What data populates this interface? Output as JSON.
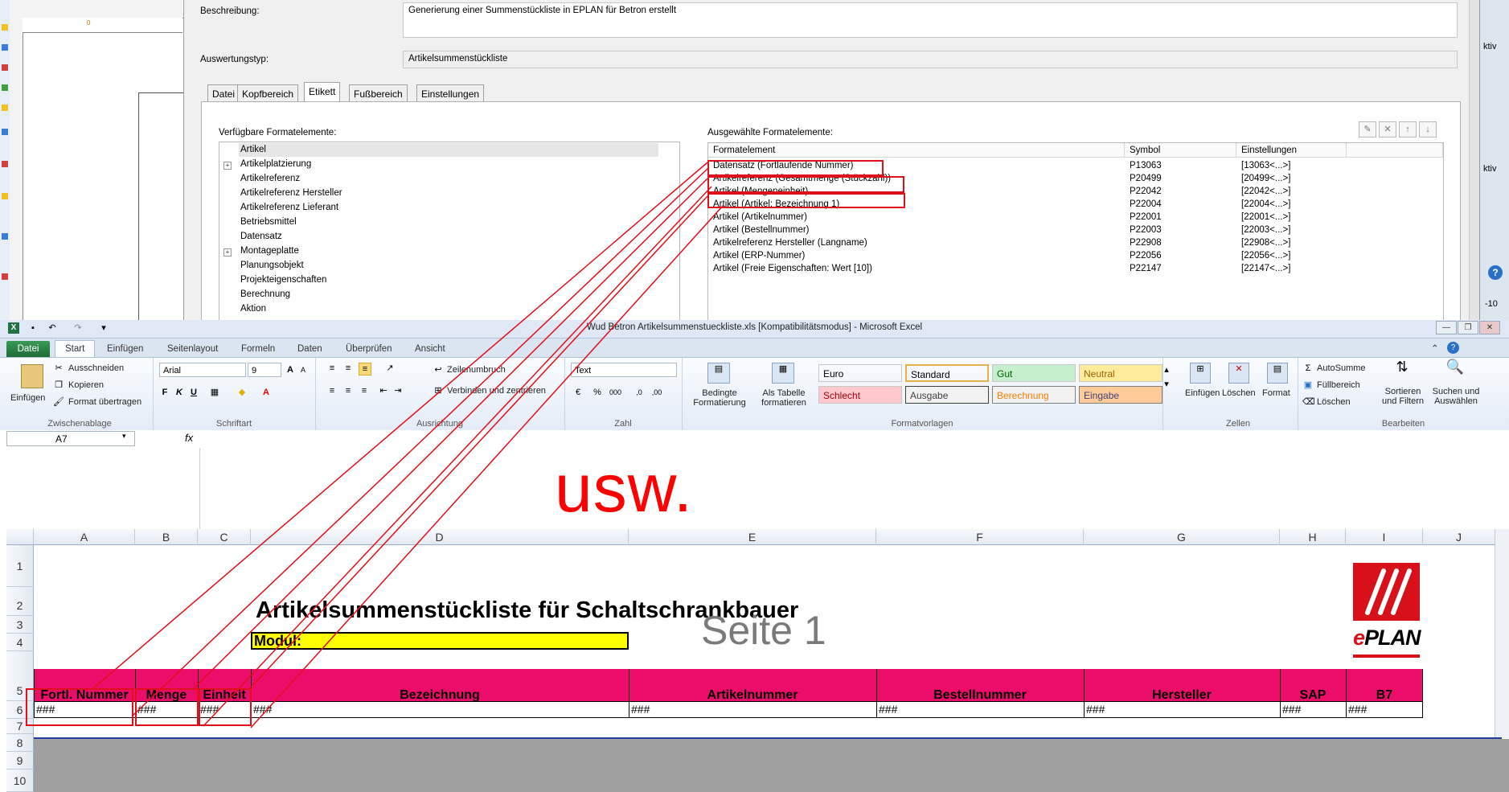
{
  "eplan": {
    "ruler_value": "0",
    "beschreibung_label": "Beschreibung:",
    "beschreibung_value": "Generierung einer Summenstückliste in EPLAN für Betron erstellt",
    "auswertungstyp_label": "Auswertungstyp:",
    "auswertungstyp_value": "Artikelsummenstückliste",
    "tabs": [
      "Datei",
      "Kopfbereich",
      "Etikett",
      "Fußbereich",
      "Einstellungen"
    ],
    "active_tab": "Etikett",
    "available_label": "Verfügbare Formatelemente:",
    "selected_label": "Ausgewählte Formatelemente:",
    "tree_items": [
      "Artikel",
      "Artikelplatzierung",
      "Artikelreferenz",
      "Artikelreferenz Hersteller",
      "Artikelreferenz Lieferant",
      "Betriebsmittel",
      "Datensatz",
      "Montageplatte",
      "Planungsobjekt",
      "Projekteigenschaften",
      "Berechnung",
      "Aktion"
    ],
    "grid_headers": [
      "Formatelement",
      "Symbol",
      "Einstellungen"
    ],
    "grid_rows": [
      {
        "element": "Datensatz (Fortlaufende Nummer)",
        "symbol": "P13063",
        "settings": "[13063<...>]"
      },
      {
        "element": "Artikelreferenz (Gesamtmenge (Stückzahl))",
        "symbol": "P20499",
        "settings": "[20499<...>]"
      },
      {
        "element": "Artikel (Mengeneinheit)",
        "symbol": "P22042",
        "settings": "[22042<...>]"
      },
      {
        "element": "Artikel (Artikel: Bezeichnung 1)",
        "symbol": "P22004",
        "settings": "[22004<...>]"
      },
      {
        "element": "Artikel (Artikelnummer)",
        "symbol": "P22001",
        "settings": "[22001<...>]"
      },
      {
        "element": "Artikel (Bestellnummer)",
        "symbol": "P22003",
        "settings": "[22003<...>]"
      },
      {
        "element": "Artikelreferenz Hersteller (Langname)",
        "symbol": "P22908",
        "settings": "[22908<...>]"
      },
      {
        "element": "Artikel (ERP-Nummer)",
        "symbol": "P22056",
        "settings": "[22056<...>]"
      },
      {
        "element": "Artikel (Freie Eigenschaften: Wert [10])",
        "symbol": "P22147",
        "settings": "[22147<...>]"
      }
    ],
    "right_strip_texts": [
      "ktiv",
      "ktiv",
      "-10"
    ]
  },
  "excel": {
    "window_title": "Wud Betron Artikelsummenstueckliste.xls  [Kompatibilitätsmodus]  -  Microsoft Excel",
    "ribbon_tabs": [
      "Datei",
      "Start",
      "Einfügen",
      "Seitenlayout",
      "Formeln",
      "Daten",
      "Überprüfen",
      "Ansicht"
    ],
    "clipboard": {
      "paste": "Einfügen",
      "cut": "Ausschneiden",
      "copy": "Kopieren",
      "format_painter": "Format übertragen",
      "label": "Zwischenablage"
    },
    "font": {
      "name": "Arial",
      "size": "9",
      "bold": "F",
      "italic": "K",
      "underline": "U",
      "label": "Schriftart"
    },
    "alignment": {
      "wrap": "Zeilenumbruch",
      "merge": "Verbinden und zentrieren",
      "label": "Ausrichtung"
    },
    "number": {
      "format": "Text",
      "label": "Zahl"
    },
    "styles": {
      "conditional": "Bedingte Formatierung",
      "as_table": "Als Tabelle formatieren",
      "label": "Formatvorlagen",
      "cells": [
        {
          "name": "Euro",
          "bg": "#ffffff",
          "fg": "#000000"
        },
        {
          "name": "Standard",
          "bg": "#ffffff",
          "fg": "#000000"
        },
        {
          "name": "Gut",
          "bg": "#c6efce",
          "fg": "#006100"
        },
        {
          "name": "Neutral",
          "bg": "#ffeb9c",
          "fg": "#9c6500"
        },
        {
          "name": "Schlecht",
          "bg": "#ffc7ce",
          "fg": "#9c0006"
        },
        {
          "name": "Ausgabe",
          "bg": "#f2f2f2",
          "fg": "#3f3f3f"
        },
        {
          "name": "Berechnung",
          "bg": "#f2f2f2",
          "fg": "#fa7d00"
        },
        {
          "name": "Eingabe",
          "bg": "#ffcc99",
          "fg": "#3f3f76"
        }
      ]
    },
    "cells_group": {
      "insert": "Einfügen",
      "delete": "Löschen",
      "format": "Format",
      "label": "Zellen"
    },
    "editing": {
      "autosum": "AutoSumme",
      "fill": "Füllbereich",
      "clear": "Löschen",
      "sort": "Sortieren und Filtern",
      "find": "Suchen und Auswählen",
      "label": "Bearbeiten"
    },
    "name_box": "A7",
    "fx": "fx",
    "annotation": "usw.",
    "columns": [
      "A",
      "B",
      "C",
      "D",
      "E",
      "F",
      "G",
      "H",
      "I",
      "J"
    ],
    "rows": [
      "1",
      "2",
      "3",
      "4",
      "5",
      "6",
      "7",
      "8",
      "9",
      "10"
    ],
    "sheet_title": "Artikelsummenstückliste für Schaltschrankbauer",
    "page_label": "Seite 1",
    "modul_label": "Modul:",
    "logo_word": "EPLAN",
    "header_labels": [
      "Fortl. Nummer",
      "Menge",
      "Einheit",
      "Bezeichnung",
      "Artikelnummer",
      "Bestellnummer",
      "Hersteller",
      "SAP",
      "B7"
    ],
    "placeholder": "###"
  },
  "colors": {
    "accent_magenta": "#ec0c6a",
    "annotation_red": "#ff0000",
    "excel_green": "#217346",
    "highlight_yellow": "#ffff00",
    "eplan_red": "#d8101a"
  }
}
